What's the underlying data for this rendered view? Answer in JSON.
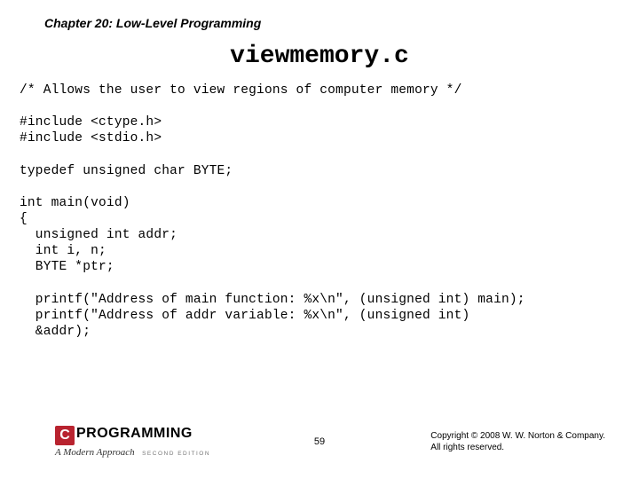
{
  "chapter": "Chapter 20: Low-Level Programming",
  "title": "viewmemory.c",
  "code": "/* Allows the user to view regions of computer memory */\n\n#include <ctype.h>\n#include <stdio.h>\n\ntypedef unsigned char BYTE;\n\nint main(void)\n{\n  unsigned int addr;\n  int i, n;\n  BYTE *ptr;\n\n  printf(\"Address of main function: %x\\n\", (unsigned int) main);\n  printf(\"Address of addr variable: %x\\n\", (unsigned int)\n  &addr);",
  "logo": {
    "c": "C",
    "word": "PROGRAMMING",
    "subtitle": "A Modern Approach",
    "edition": "SECOND EDITION"
  },
  "page_number": "59",
  "copyright_line1": "Copyright © 2008 W. W. Norton & Company.",
  "copyright_line2": "All rights reserved."
}
